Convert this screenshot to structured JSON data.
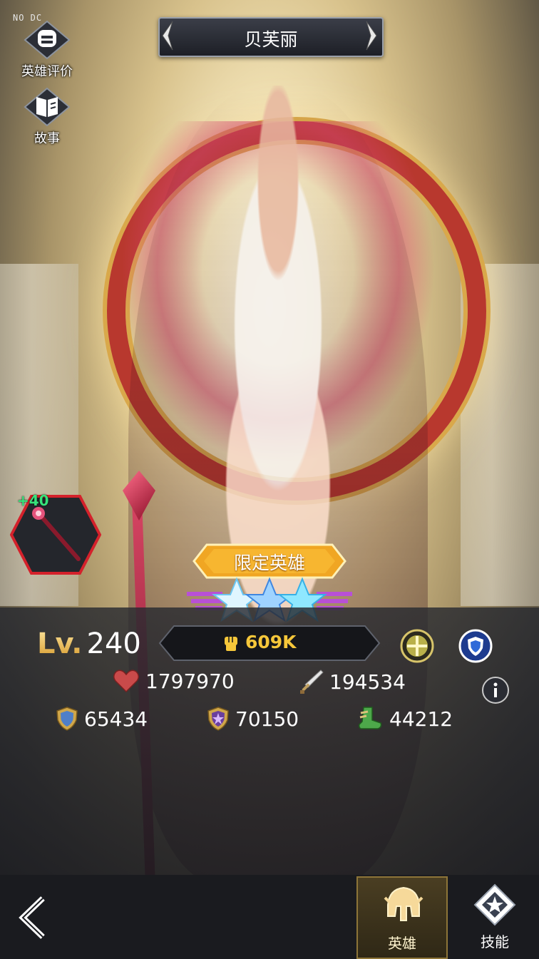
{
  "corner_tag": "NO DC",
  "header": {
    "title": "贝芙丽"
  },
  "side_menu": {
    "review_label": "英雄评价",
    "story_label": "故事"
  },
  "equipment": {
    "enhance": "+40",
    "icon": "staff-icon"
  },
  "badge": {
    "label": "限定英雄",
    "stars": 3
  },
  "stats": {
    "level_prefix": "Lv.",
    "level": "240",
    "power": "609K",
    "hp": "1797970",
    "attack": "194534",
    "defense": "65434",
    "magic_defense": "70150",
    "speed": "44212"
  },
  "tabs": {
    "hero_label": "英雄",
    "skill_label": "技能"
  },
  "colors": {
    "accent_gold": "#f6c73a",
    "equip_plus": "#36e37b",
    "frame_red": "#d4212b"
  }
}
